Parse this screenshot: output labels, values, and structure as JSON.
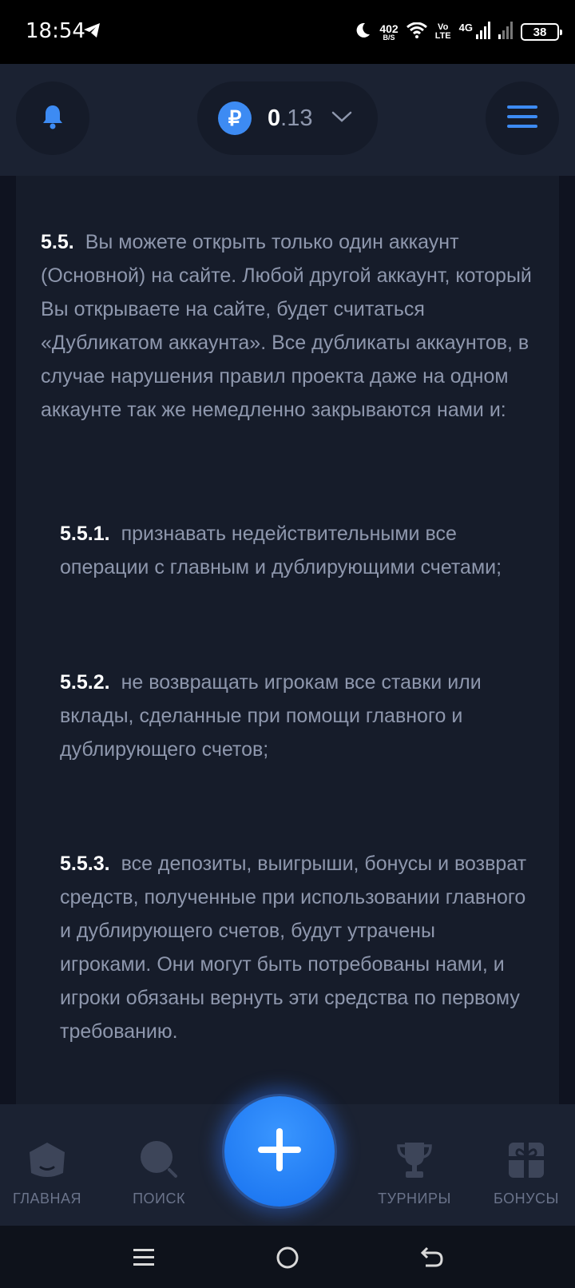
{
  "status_bar": {
    "time": "18:54",
    "net_speed": "402",
    "net_speed_unit": "B/S",
    "volte_top": "Vo",
    "volte_bottom": "LTE",
    "network": "4G",
    "battery": "38",
    "icons": [
      "telegram-icon",
      "moon-icon",
      "wifi-icon",
      "signal-icon",
      "signal-weak-icon",
      "battery-icon"
    ]
  },
  "header": {
    "balance_int": "0",
    "balance_frac": ".13",
    "currency_symbol": "₽",
    "accent": "#3d8bf3",
    "icons": [
      "bell-icon",
      "ruble-icon",
      "chevron-down-icon",
      "menu-icon"
    ]
  },
  "rules": {
    "main": {
      "num": "5.5.",
      "text": "Вы можете открыть только один аккаунт (Основной) на сайте. Любой другой аккаунт, который Вы открываете на сайте, будет считаться «Дубликатом аккаунта». Все дубликаты аккаунтов, в случае нарушения правил проекта даже на одном аккаунте так же немедленно закрываются нами и:"
    },
    "items": [
      {
        "num": "5.5.1.",
        "text": "признавать недействительными все операции с главным и дублирующими счетами;"
      },
      {
        "num": "5.5.2.",
        "text": "не возвращать игрокам все ставки или вклады, сделанные при помощи главного и дублирующего счетов;"
      },
      {
        "num": "5.5.3.",
        "text": "все депозиты, выигрыши, бонусы и возврат средств, полученные при использовании главного и дублирующего счетов, будут утрачены игроками. Они могут быть потребованы нами, и игроки обязаны вернуть эти средства по первому требованию."
      }
    ]
  },
  "bottom_nav": {
    "home": "ГЛАВНАЯ",
    "search": "ПОИСК",
    "tournaments": "ТУРНИРЫ",
    "bonuses": "БОНУСЫ",
    "icons": [
      "home-icon",
      "search-icon",
      "plus-icon",
      "trophy-icon",
      "gift-icon"
    ]
  },
  "system_nav": {
    "icons": [
      "recents-icon",
      "home-circle-icon",
      "back-icon"
    ]
  }
}
